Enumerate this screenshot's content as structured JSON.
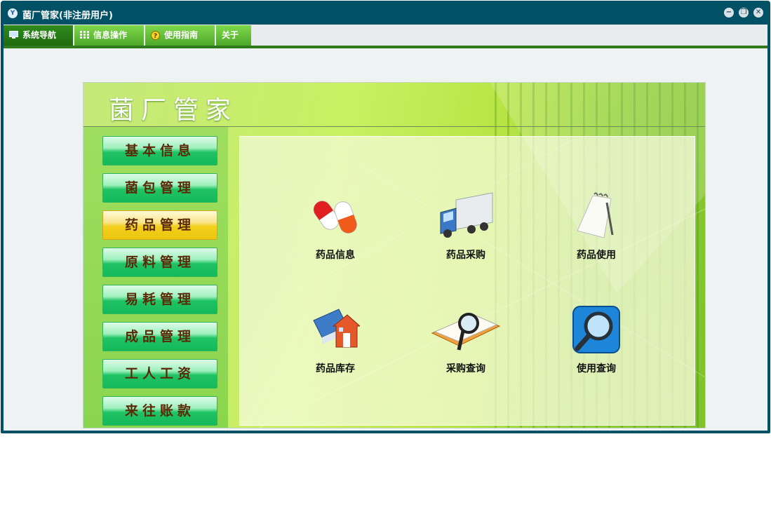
{
  "window": {
    "title": "菌厂管家(非注册用户)",
    "logo_letter": "Y",
    "controls": {
      "minimize": "−",
      "restore": "❐",
      "close": "✕"
    }
  },
  "menu": {
    "tabs": [
      {
        "label": "系统导航",
        "icon": "monitor-icon",
        "active": true
      },
      {
        "label": "信息操作",
        "icon": "grid-icon",
        "active": false
      },
      {
        "label": "使用指南",
        "icon": "help-icon",
        "active": false
      },
      {
        "label": "关于",
        "icon": "",
        "active": false
      }
    ]
  },
  "panel": {
    "title": "菌厂管家"
  },
  "nav": {
    "items": [
      {
        "label": "基本信息",
        "active": false
      },
      {
        "label": "菌包管理",
        "active": false
      },
      {
        "label": "药品管理",
        "active": true
      },
      {
        "label": "原料管理",
        "active": false
      },
      {
        "label": "易耗管理",
        "active": false
      },
      {
        "label": "成品管理",
        "active": false
      },
      {
        "label": "工人工资",
        "active": false
      },
      {
        "label": "来往账款",
        "active": false
      }
    ]
  },
  "tiles": [
    {
      "label": "药品信息",
      "icon": "pill-capsule-icon"
    },
    {
      "label": "药品采购",
      "icon": "truck-icon"
    },
    {
      "label": "药品使用",
      "icon": "notepad-pen-icon"
    },
    {
      "label": "药品库存",
      "icon": "warehouse-book-icon"
    },
    {
      "label": "采购查询",
      "icon": "magnifier-document-icon"
    },
    {
      "label": "使用查询",
      "icon": "search-button-icon"
    }
  ],
  "colors": {
    "window_frame": "#005066",
    "menu_active": "#2f8b1c",
    "menu_inactive": "#6ccb3f",
    "nav_button": "#1fc364",
    "nav_active": "#f3d01e",
    "nav_text": "#5a2a08"
  }
}
